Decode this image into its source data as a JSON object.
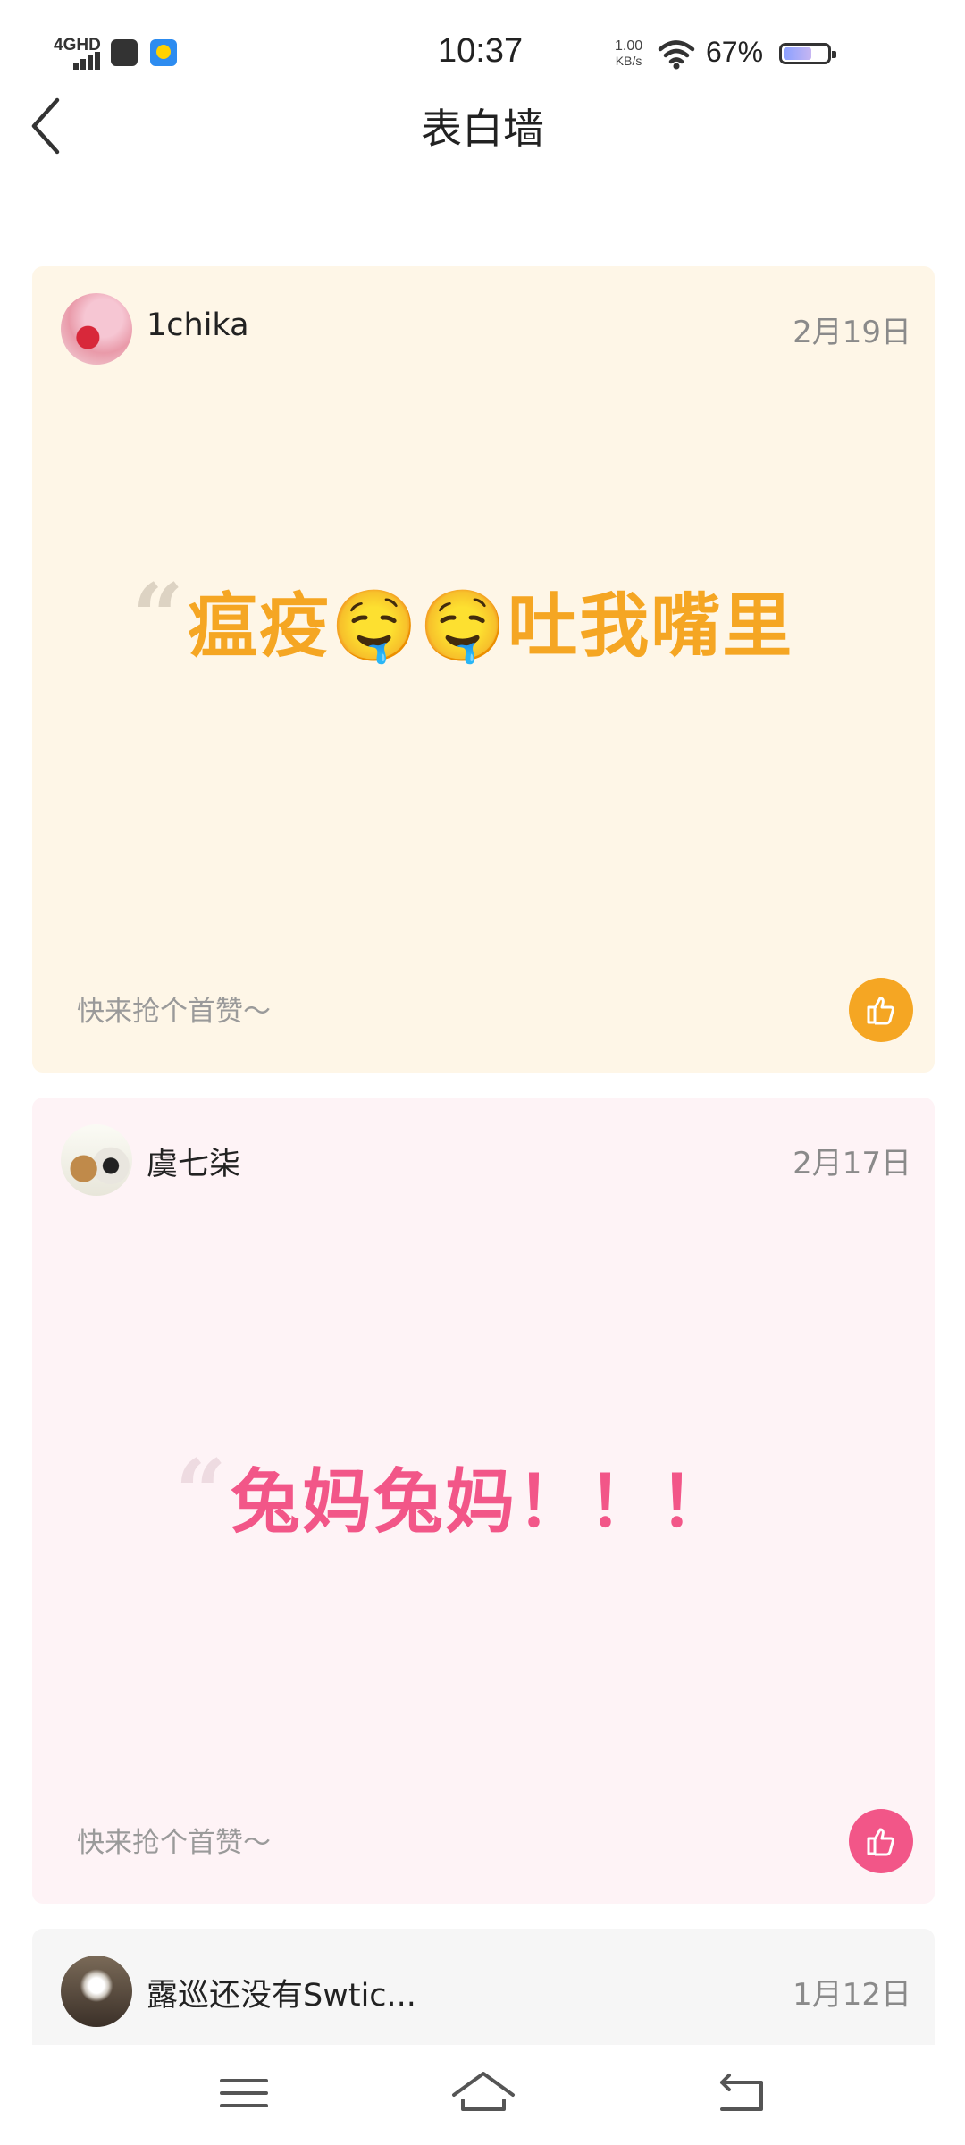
{
  "status_bar": {
    "network": "4GHD",
    "time": "10:37",
    "speed_value": "1.00",
    "speed_unit": "KB/s",
    "battery_percent": "67%",
    "battery_level": 0.67
  },
  "header": {
    "title": "表白墙"
  },
  "posts": [
    {
      "author": "1chika",
      "date": "2月19日",
      "content": "瘟疫🤤🤤吐我嘴里",
      "like_hint": "快来抢个首赞～",
      "accent_color": "#f5a623",
      "background": "#fef6e7"
    },
    {
      "author": "虞七柒",
      "date": "2月17日",
      "content": "兔妈兔妈！！！",
      "like_hint": "快来抢个首赞～",
      "accent_color": "#f25688",
      "background": "#fef3f6"
    },
    {
      "author": "露巡还没有Swtic...",
      "date": "1月12日",
      "background": "#f6f6f6"
    }
  ],
  "icons": {
    "back": "chevron-left-icon",
    "like": "thumbs-up-icon",
    "menu": "menu-icon",
    "home": "home-icon",
    "return": "return-icon"
  }
}
